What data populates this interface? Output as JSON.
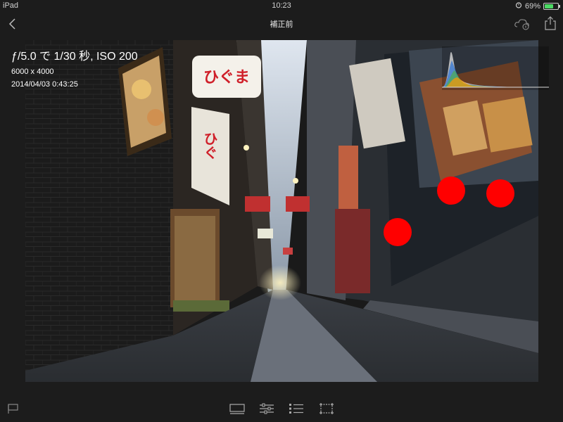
{
  "status_bar": {
    "device": "iPad",
    "time": "10:23",
    "battery": "69%",
    "battery_level": 0.69,
    "icons": [
      "alarm-icon",
      "battery-icon"
    ]
  },
  "nav": {
    "title": "補正前",
    "icons": [
      "chevron-left-icon",
      "cloud-info-icon",
      "share-icon"
    ]
  },
  "photo_info": {
    "exif": "ƒ/5.0 で 1/30 秒, ISO 200",
    "dimensions": "6000 x 4000",
    "date": "2014/04/03 0:43:25"
  },
  "signs": {
    "main": "ひぐま",
    "vertical": "ひぐ"
  },
  "toolbar": {
    "icons": [
      "flag-icon",
      "filmstrip-icon",
      "adjust-sliders-icon",
      "list-icon",
      "crop-icon"
    ]
  },
  "colors": {
    "background": "#1c1c1c",
    "marker": "#ff0000",
    "battery": "#4cd964"
  }
}
